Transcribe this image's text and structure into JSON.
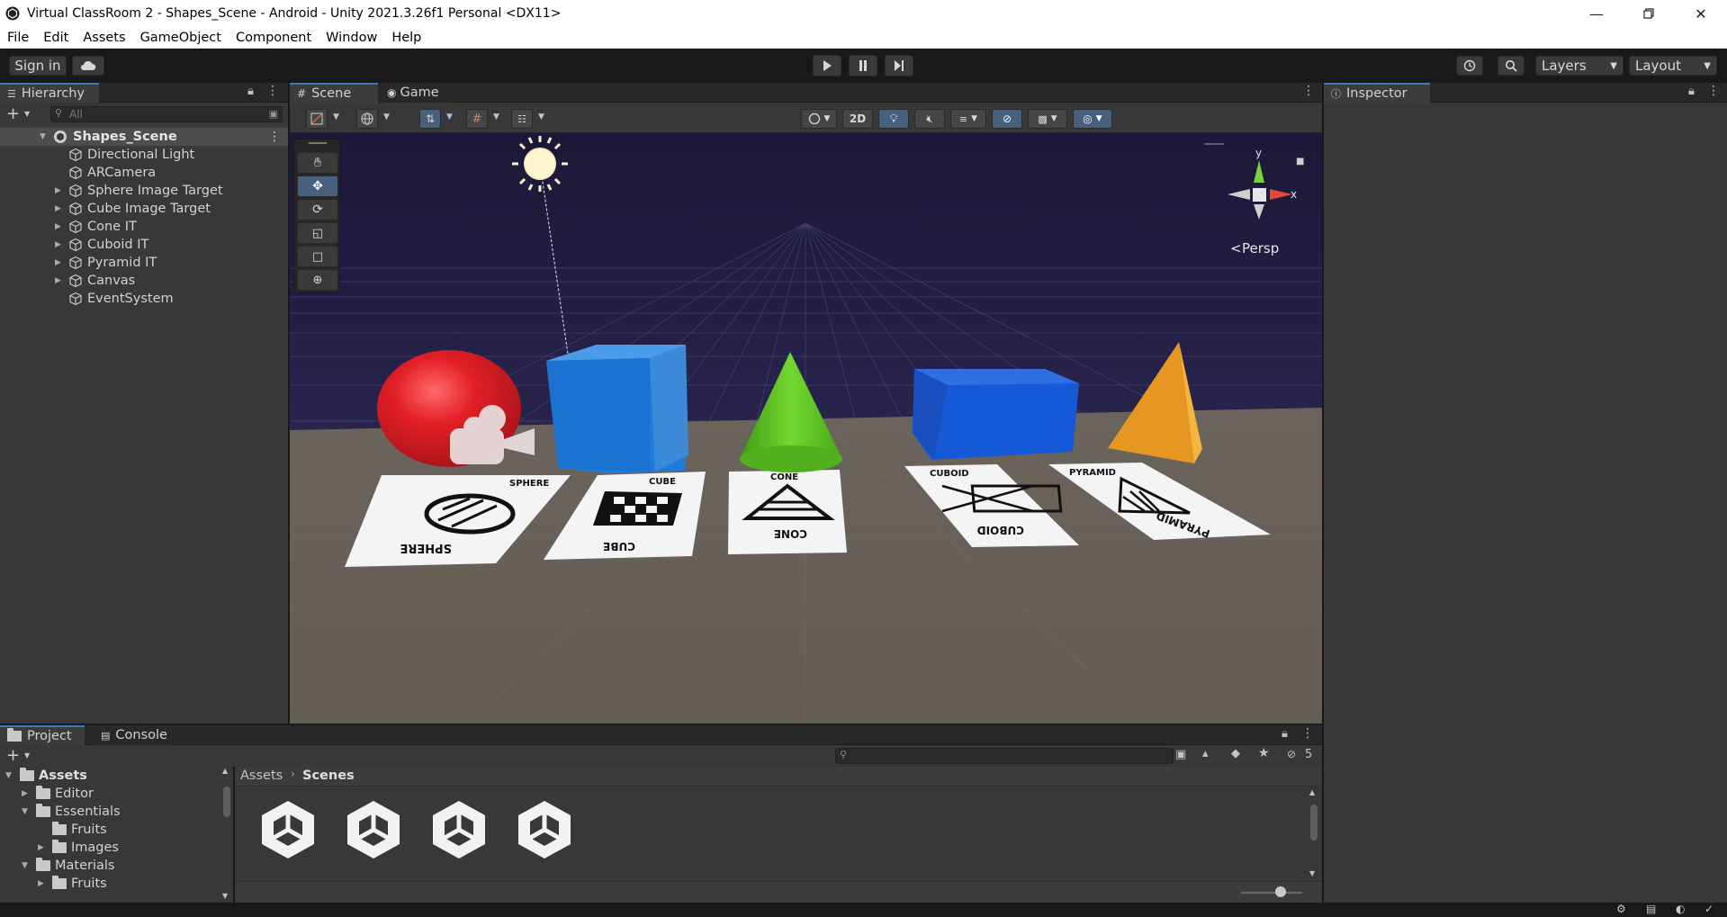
{
  "window": {
    "title": "Virtual ClassRoom 2 - Shapes_Scene - Android - Unity 2021.3.26f1 Personal <DX11>",
    "controls": [
      "minimize-icon",
      "restore-icon",
      "close-icon"
    ]
  },
  "menu": [
    "File",
    "Edit",
    "Assets",
    "GameObject",
    "Component",
    "Window",
    "Help"
  ],
  "toolbar": {
    "sign_in": "Sign in",
    "layers": "Layers",
    "layout": "Layout"
  },
  "hierarchy": {
    "tab": "Hierarchy",
    "search_placeholder": "All",
    "scene_name": "Shapes_Scene",
    "items": [
      {
        "label": "Directional Light",
        "expandable": false
      },
      {
        "label": "ARCamera",
        "expandable": false
      },
      {
        "label": "Sphere Image Target",
        "expandable": true
      },
      {
        "label": "Cube Image Target",
        "expandable": true
      },
      {
        "label": "Cone IT",
        "expandable": true
      },
      {
        "label": "Cuboid IT",
        "expandable": true
      },
      {
        "label": "Pyramid IT",
        "expandable": true
      },
      {
        "label": "Canvas",
        "expandable": true
      },
      {
        "label": "EventSystem",
        "expandable": false
      }
    ]
  },
  "scene": {
    "tabs": [
      "Scene",
      "Game"
    ],
    "toolbar_2d": "2D",
    "persp_label": "Persp",
    "gizmo_y": "y",
    "gizmo_x": "x",
    "markers": [
      {
        "top": "SPHERE",
        "bottom": "SPHERE"
      },
      {
        "top": "CUBE",
        "bottom": "CUBE"
      },
      {
        "top": "CONE",
        "bottom": "CONE"
      },
      {
        "top": "CUBOID",
        "bottom": "CUBOID"
      },
      {
        "top": "PYRAMID",
        "bottom": "PYRAMID"
      }
    ]
  },
  "inspector": {
    "tab": "Inspector"
  },
  "project": {
    "tabs": [
      "Project",
      "Console"
    ],
    "hidden_count": "5",
    "breadcrumb": [
      "Assets",
      "Scenes"
    ],
    "tree": [
      {
        "label": "Assets",
        "depth": 0,
        "arrow": "down",
        "bold": true
      },
      {
        "label": "Editor",
        "depth": 1,
        "arrow": "right"
      },
      {
        "label": "Essentials",
        "depth": 1,
        "arrow": "down"
      },
      {
        "label": "Fruits",
        "depth": 2,
        "arrow": "none"
      },
      {
        "label": "Images",
        "depth": 2,
        "arrow": "right"
      },
      {
        "label": "Materials",
        "depth": 1,
        "arrow": "down"
      },
      {
        "label": "Fruits",
        "depth": 2,
        "arrow": "right"
      }
    ],
    "scene_asset_count": 4
  },
  "colors": {
    "accent_blue": "#3a79bb",
    "sky": "#231f47",
    "ground": "#6e675f",
    "sphere": "#e21f26",
    "cube": "#1a73d4",
    "cone": "#57c21f",
    "cuboid": "#1559d6",
    "pyramid": "#f0a020"
  }
}
